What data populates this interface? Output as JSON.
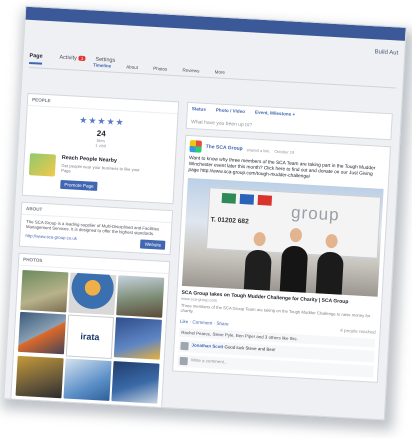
{
  "header": {
    "home_link": "Build Aut"
  },
  "tabs": [
    {
      "label": "Page"
    },
    {
      "label": "Activity",
      "badge": "1"
    },
    {
      "label": "Settings"
    }
  ],
  "subtabs": [
    "Timeline",
    "About",
    "Photos",
    "Reviews",
    "More"
  ],
  "left": {
    "rating": {
      "head": "PEOPLE",
      "stars": "★★★★★",
      "count": "24",
      "count_label": "likes",
      "rating": "1 visit"
    },
    "reach": {
      "title": "Reach People Nearby",
      "desc": "Get people near your business to like your Page",
      "button": "Promote Page"
    },
    "about": {
      "head": "ABOUT",
      "text": "The SCA Group is a leading supplier of Multi-Disciplined and Facilities Management Services. It is designed to offer the highest standards.",
      "url": "http://www.sca-group.co.uk",
      "link": "Website"
    },
    "photos": {
      "head": "PHOTOS"
    }
  },
  "composer": {
    "status": "Status",
    "photo": "Photo / Video",
    "event": "Event, Milestone +",
    "prompt": "What have you been up to?"
  },
  "post": {
    "author": "The SCA Group",
    "meta": "shared a link.",
    "date": "October 19",
    "text": "Want to know why three members of the SCA Team are taking part in the Tough Mudder Winchester event later this month? Click here to find out and donate on our Just Giving page http://www.sca-group.com/tough-mudder-challenge/",
    "image_word": "group",
    "image_phone": "T. 01202 682",
    "link_title": "SCA Group takes on Tough Mudder Challenge for Charity | SCA Group",
    "link_url": "www.sca-group.com",
    "link_desc": "Three members of the SCA Group Team are taking on the Tough Mudder Challenge to raise money for charity.",
    "actions": {
      "like": "Like",
      "comment": "Comment",
      "share": "Share",
      "reach": "4 people reached"
    },
    "likes": "Rachel Pearce, Steve Pyle, Ben Piper and 3 others like this.",
    "comment_author": "Jonathan Scott",
    "comment_text": "Good luck Steve and Ben!",
    "write": "Write a comment..."
  }
}
